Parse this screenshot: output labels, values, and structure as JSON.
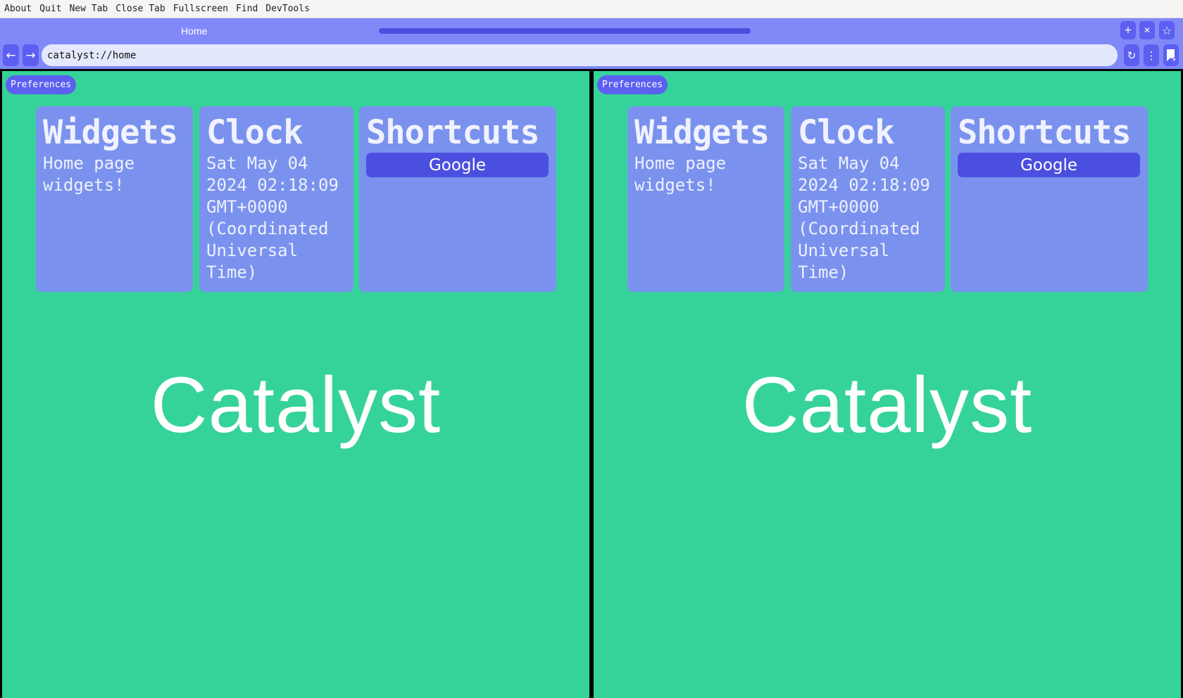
{
  "menu": [
    "About",
    "Quit",
    "New Tab",
    "Close Tab",
    "Fullscreen",
    "Find",
    "DevTools"
  ],
  "tab": {
    "title": "Home",
    "load_progress": 1.0
  },
  "window_buttons": {
    "new_tab_icon": "plus-icon",
    "close_icon": "close-icon",
    "bookmark_icon": "star-icon"
  },
  "nav": {
    "back_icon": "arrow-left-icon",
    "forward_icon": "arrow-right-icon",
    "url": "catalyst://home",
    "reload_icon": "reload-icon",
    "menu_icon": "kebab-menu-icon",
    "bookmarks_icon": "bookmark-list-icon"
  },
  "panes": [
    {
      "preferences_label": "Preferences",
      "widgets": {
        "title": "Widgets",
        "text": "Home page widgets!"
      },
      "clock": {
        "title": "Clock",
        "text": "Sat May 04 2024 02:18:09 GMT+0000 (Coordinated Universal Time)"
      },
      "shortcuts": {
        "title": "Shortcuts",
        "items": [
          "Google"
        ]
      },
      "brand": "Catalyst"
    },
    {
      "preferences_label": "Preferences",
      "widgets": {
        "title": "Widgets",
        "text": "Home page widgets!"
      },
      "clock": {
        "title": "Clock",
        "text": "Sat May 04 2024 02:18:09 GMT+0000 (Coordinated Universal Time)"
      },
      "shortcuts": {
        "title": "Shortcuts",
        "items": [
          "Google"
        ]
      },
      "brand": "Catalyst"
    }
  ],
  "colors": {
    "accent": "#5c5ff0",
    "chrome": "#8189f9",
    "card": "#7a92ee",
    "page_background": "#35d399"
  }
}
